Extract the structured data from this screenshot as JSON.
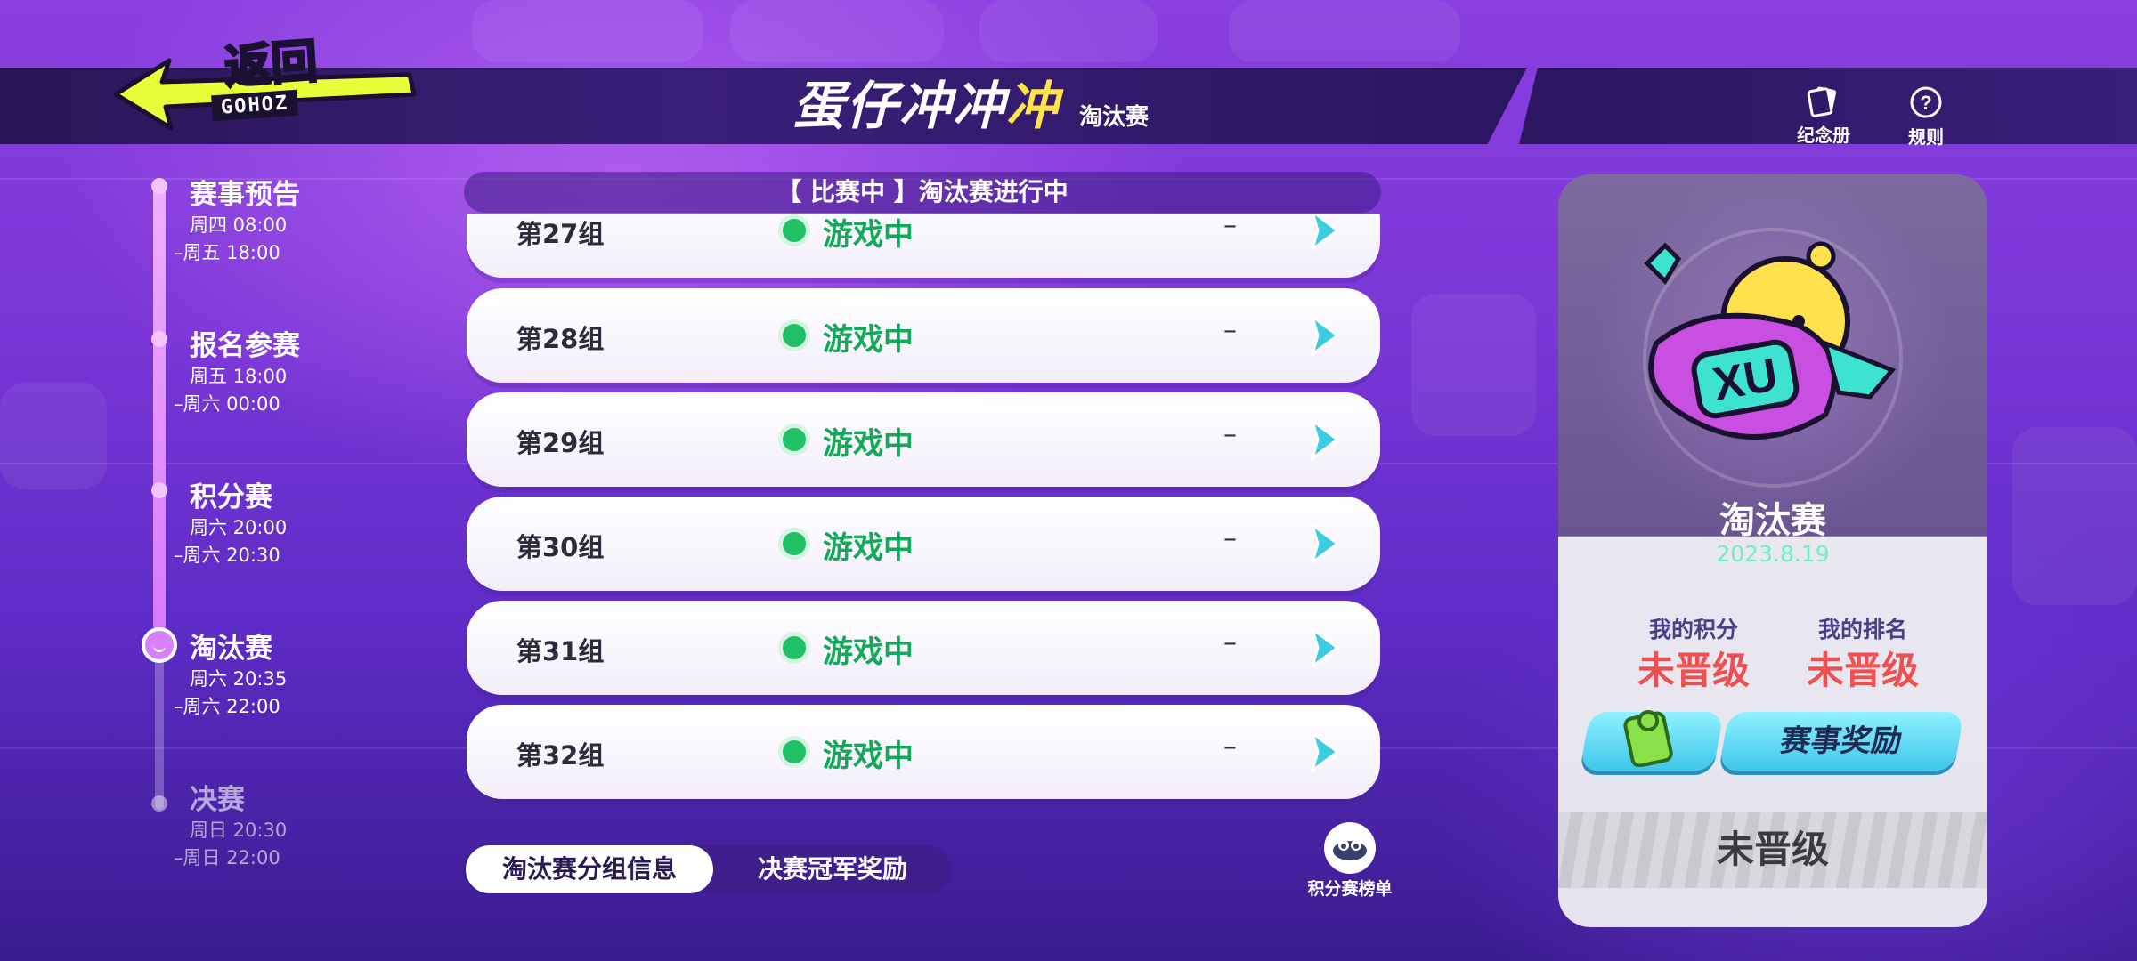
{
  "header": {
    "back_label": "返回",
    "back_sub": "GOHOZ",
    "title_main": "蛋仔冲冲",
    "title_accent": "冲",
    "subtitle": "淘汰赛",
    "icons": {
      "album": {
        "label": "纪念册",
        "icon": "album-card-icon"
      },
      "rules": {
        "label": "规则",
        "icon": "question-circle-icon"
      }
    }
  },
  "timeline": [
    {
      "name": "赛事预告",
      "time1": "周四 08:00",
      "time2": "–周五 18:00"
    },
    {
      "name": "报名参赛",
      "time1": "周五 18:00",
      "time2": "–周六 00:00"
    },
    {
      "name": "积分赛",
      "time1": "周六 20:00",
      "time2": "–周六 20:30"
    },
    {
      "name": "淘汰赛",
      "time1": "周六 20:35",
      "time2": "–周六 22:00"
    },
    {
      "name": "决赛",
      "time1": "周日 20:30",
      "time2": "–周日 22:00"
    }
  ],
  "status_banner": "【 比赛中 】淘汰赛进行中",
  "groups": [
    {
      "name": "第27组",
      "status": "游戏中",
      "score": "–"
    },
    {
      "name": "第28组",
      "status": "游戏中",
      "score": "–"
    },
    {
      "name": "第29组",
      "status": "游戏中",
      "score": "–"
    },
    {
      "name": "第30组",
      "status": "游戏中",
      "score": "–"
    },
    {
      "name": "第31组",
      "status": "游戏中",
      "score": "–"
    },
    {
      "name": "第32组",
      "status": "游戏中",
      "score": "–"
    }
  ],
  "tabs": {
    "group_info": "淘汰赛分组信息",
    "final_reward": "决赛冠军奖励"
  },
  "ranking_button": {
    "label": "积分赛榜单",
    "icon": "ranking-icon"
  },
  "card": {
    "title": "淘汰赛",
    "date": "2023.8.19",
    "my_score_label": "我的积分",
    "my_score_value": "未晋级",
    "my_rank_label": "我的排名",
    "my_rank_value": "未晋级",
    "reward_button": "赛事奖励",
    "bottom_status": "未晋级",
    "badge_text": "XU"
  },
  "colors": {
    "accent_yellow": "#ffe34a",
    "status_green": "#14a85a",
    "value_red": "#ef4f4f",
    "date_teal": "#6ff0c0",
    "button_cyan": "#3fc7ea"
  }
}
